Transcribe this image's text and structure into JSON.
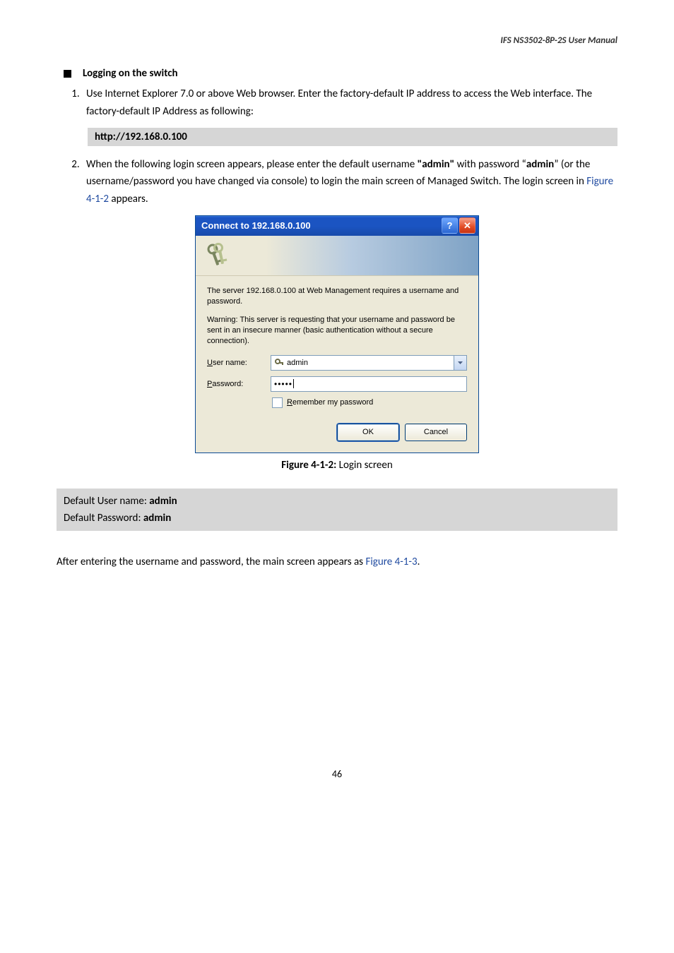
{
  "header": {
    "title": "IFS  NS3502-8P-2S  User  Manual"
  },
  "section_heading": "Logging on the switch",
  "step1": "Use Internet Explorer 7.0 or above Web browser. Enter the factory-default IP address to access the Web interface. The factory-default IP Address as following:",
  "code_bar": "http://192.168.0.100",
  "step2_pre": "When the following login screen appears, please enter the default username ",
  "step2_admin1": "\"admin\"",
  "step2_mid1": " with password “",
  "step2_admin2": "admin",
  "step2_mid2": "” (or the username/password you have changed via console) to login the main screen of Managed Switch. The login screen in ",
  "step2_figref": "Figure 4-1-2",
  "step2_end": " appears.",
  "dialog": {
    "title": "Connect to 192.168.0.100",
    "help_glyph": "?",
    "close_glyph": "✕",
    "paragraph1": "The server 192.168.0.100 at Web Management requires a username and password.",
    "paragraph2": "Warning: This server is requesting that your username and password be sent in an insecure manner (basic authentication without a secure connection).",
    "username_label_u": "U",
    "username_label_rest": "ser name:",
    "username_value": "admin",
    "password_label_u": "P",
    "password_label_rest": "assword:",
    "password_dots": "•••••",
    "remember_u": "R",
    "remember_rest": "emember my password",
    "ok": "OK",
    "cancel": "Cancel"
  },
  "caption_label": "Figure 4-1-2:",
  "caption_text": " Login screen",
  "defaults": {
    "line1_pre": "Default User name: ",
    "line1_val": "admin",
    "line2_pre": "Default Password: ",
    "line2_val": "admin"
  },
  "after_pre": "After entering the username and password, the main screen appears as ",
  "after_figref": "Figure 4-1-3",
  "after_end": ".",
  "page_number": "46"
}
